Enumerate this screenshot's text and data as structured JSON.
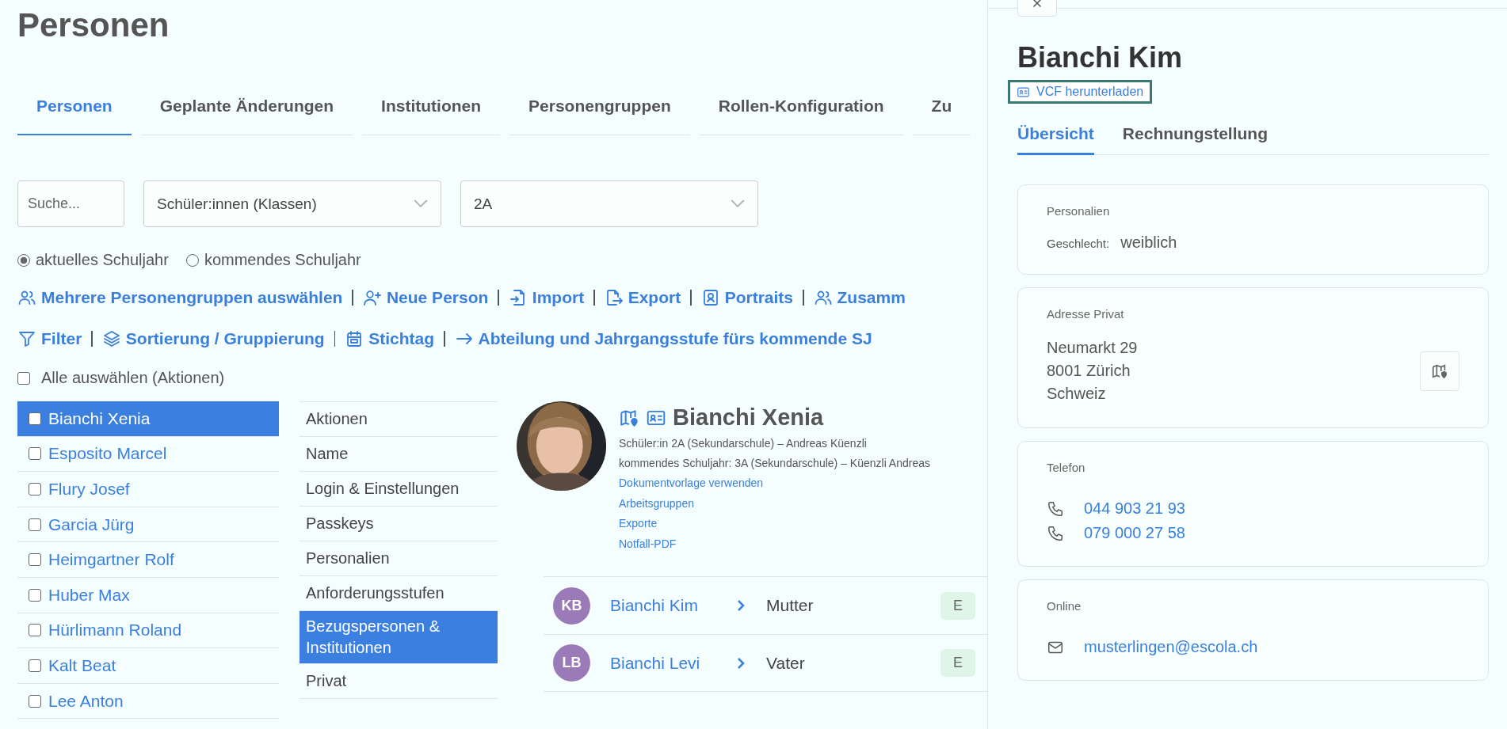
{
  "page_title": "Personen",
  "tabs": [
    {
      "label": "Personen",
      "selected": true
    },
    {
      "label": "Geplante Änderungen",
      "selected": false
    },
    {
      "label": "Institutionen",
      "selected": false
    },
    {
      "label": "Personengruppen",
      "selected": false
    },
    {
      "label": "Rollen-Konfiguration",
      "selected": false
    },
    {
      "label": "Zu",
      "selected": false
    }
  ],
  "search": {
    "placeholder": "Suche..."
  },
  "selects": [
    {
      "value": "Schüler:innen (Klassen)"
    },
    {
      "value": "2A"
    }
  ],
  "school_year": [
    {
      "label": "aktuelles Schuljahr",
      "selected": true
    },
    {
      "label": "kommendes Schuljahr",
      "selected": false
    }
  ],
  "toolbar_rows": [
    [
      {
        "kind": "users",
        "label": "Mehrere Personengruppen auswählen"
      },
      {
        "kind": "user-plus",
        "label": "Neue Person"
      },
      {
        "kind": "import",
        "label": "Import"
      },
      {
        "kind": "export",
        "label": "Export"
      },
      {
        "kind": "portrait",
        "label": "Portraits"
      },
      {
        "kind": "users",
        "label": "Zusamm"
      }
    ],
    [
      {
        "kind": "filter",
        "label": "Filter"
      },
      {
        "kind": "layers",
        "label": "Sortierung / Gruppierung"
      },
      {
        "kind": "calendar",
        "label": "Stichtag"
      },
      {
        "kind": "arrow",
        "label": "Abteilung und Jahrgangsstufe fürs kommende SJ"
      }
    ]
  ],
  "select_all": {
    "label": "Alle auswählen (Aktionen)",
    "checked": false
  },
  "persons": [
    {
      "name": "Bianchi Xenia",
      "selected": true,
      "checked": false
    },
    {
      "name": "Esposito Marcel",
      "selected": false,
      "checked": false
    },
    {
      "name": "Flury Josef",
      "selected": false,
      "checked": false
    },
    {
      "name": "Garcia Jürg",
      "selected": false,
      "checked": false
    },
    {
      "name": "Heimgartner Rolf",
      "selected": false,
      "checked": false
    },
    {
      "name": "Huber Max",
      "selected": false,
      "checked": false
    },
    {
      "name": "Hürlimann Roland",
      "selected": false,
      "checked": false
    },
    {
      "name": "Kalt Beat",
      "selected": false,
      "checked": false
    },
    {
      "name": "Lee Anton",
      "selected": false,
      "checked": false
    }
  ],
  "sections": [
    {
      "label": "Aktionen",
      "selected": false
    },
    {
      "label": "Name",
      "selected": false
    },
    {
      "label": "Login & Einstellungen",
      "selected": false
    },
    {
      "label": "Passkeys",
      "selected": false
    },
    {
      "label": "Personalien",
      "selected": false
    },
    {
      "label": "Anforderungsstufen",
      "selected": false
    },
    {
      "label": "Bezugspersonen & Institutionen",
      "selected": true
    },
    {
      "label": "Privat",
      "selected": false
    }
  ],
  "profile": {
    "name": "Bianchi Xenia",
    "lines": [
      "Schüler:in 2A (Sekundarschule) – Andreas Küenzli",
      "kommendes Schuljahr: 3A (Sekundarschule) – Küenzli Andreas"
    ],
    "links": [
      "Dokumentvorlage verwenden",
      "Arbeitsgruppen",
      "Exporte",
      "Notfall-PDF"
    ]
  },
  "relations": [
    {
      "initials": "KB",
      "name": "Bianchi Kim",
      "role": "Mutter",
      "badge": "E"
    },
    {
      "initials": "LB",
      "name": "Bianchi Levi",
      "role": "Vater",
      "badge": "E"
    }
  ],
  "panel": {
    "title": "Bianchi Kim",
    "vcf_link": "VCF herunterladen",
    "tabs": [
      {
        "label": "Übersicht",
        "selected": true
      },
      {
        "label": "Rechnungstellung",
        "selected": false
      }
    ],
    "cards": [
      {
        "kind": "fields",
        "title": "Personalien",
        "fields": [
          {
            "label": "Geschlecht:",
            "value": "weiblich"
          }
        ]
      },
      {
        "kind": "address",
        "title": "Adresse Privat",
        "lines": [
          "Neumarkt 29",
          "8001 Zürich",
          "Schweiz"
        ]
      },
      {
        "kind": "phones",
        "title": "Telefon",
        "items": [
          "044 903 21 93",
          "079 000 27 58"
        ]
      },
      {
        "kind": "emails",
        "title": "Online",
        "items": [
          "musterlingen@escola.ch"
        ]
      }
    ]
  }
}
